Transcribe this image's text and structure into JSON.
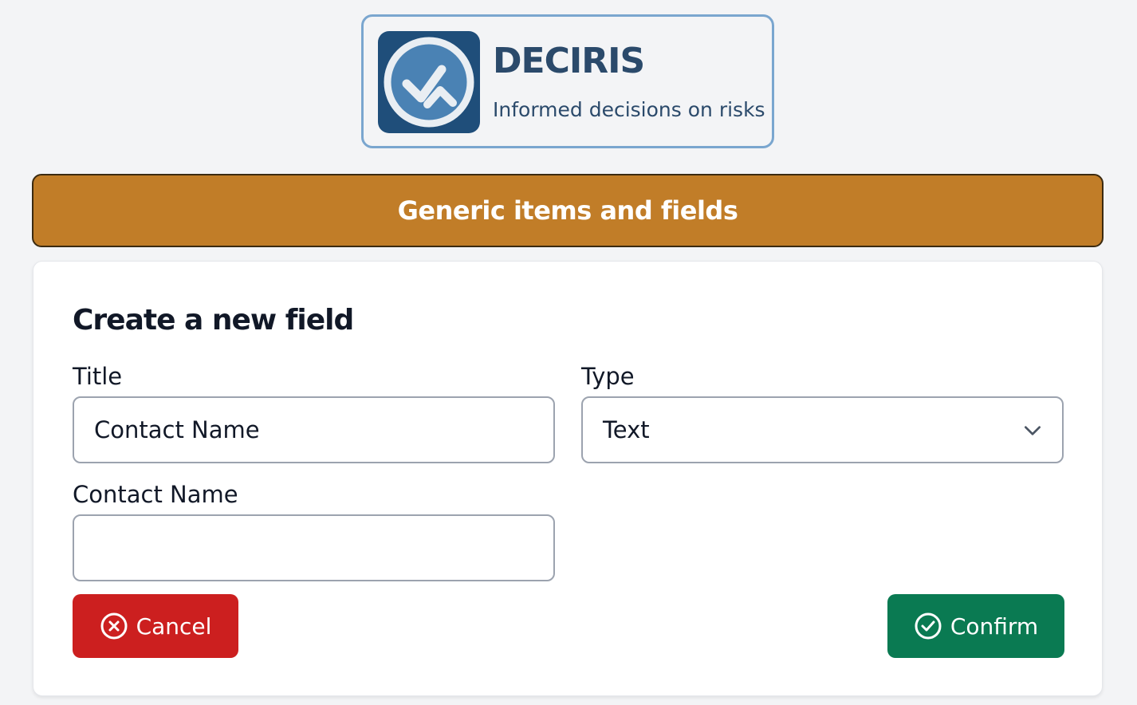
{
  "brand": {
    "name": "DECIRIS",
    "tagline": "Informed decisions on risks"
  },
  "banner": {
    "title": "Generic items and fields"
  },
  "form": {
    "heading": "Create a new field",
    "title_label": "Title",
    "title_value": "Contact Name",
    "type_label": "Type",
    "type_value": "Text",
    "value_label": "Contact Name",
    "value_value": ""
  },
  "actions": {
    "cancel_label": "Cancel",
    "confirm_label": "Confirm"
  },
  "colors": {
    "banner": "#c17d28",
    "cancel": "#cc1f1f",
    "confirm": "#0a7a52",
    "brand": "#2b4a6b"
  },
  "icons": [
    "logo-icon",
    "chevron-down-icon",
    "x-circle-icon",
    "check-circle-icon"
  ]
}
